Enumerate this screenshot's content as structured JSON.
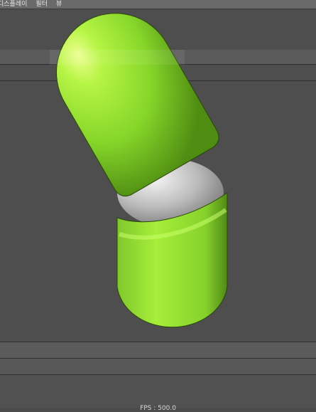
{
  "menu": {
    "items": [
      {
        "label": "디스플레이"
      },
      {
        "label": "필터"
      },
      {
        "label": "뷰"
      }
    ]
  },
  "status": {
    "fps_text": "FPS : 500.0"
  },
  "colors": {
    "background": "#4e4e4e",
    "capsule_green": "#8fe02a",
    "joint_gray": "#c8c8c8"
  }
}
